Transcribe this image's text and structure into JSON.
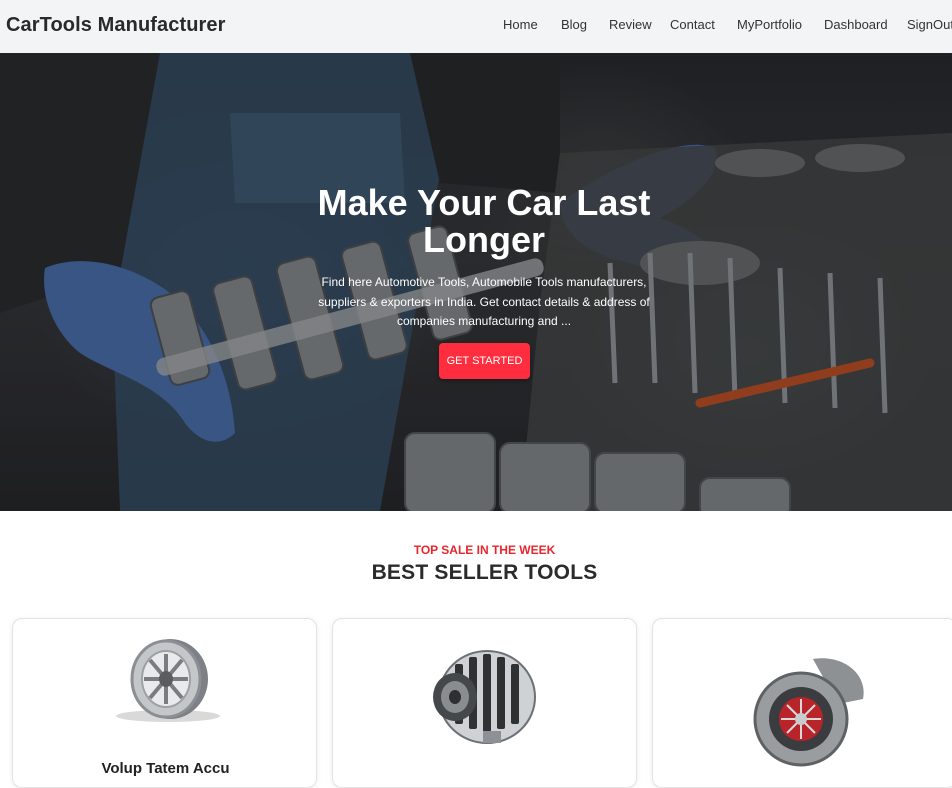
{
  "navbar": {
    "brand": "CarTools Manufacturer",
    "links": [
      "Home",
      "Blog",
      "Review",
      "Contact",
      "MyPortfolio",
      "Dashboard",
      "SignOut"
    ]
  },
  "hero": {
    "title": "Make Your Car Last Longer",
    "description": "Find here Automotive Tools, Automobile Tools manufacturers, suppliers & exporters in India. Get contact details & address of companies manufacturing and ...",
    "cta_label": "GET STARTED"
  },
  "section": {
    "subtitle": "TOP SALE IN THE WEEK",
    "title": "BEST SELLER TOOLS"
  },
  "products": [
    {
      "title": "Volup Tatem Accu",
      "image": "wheel-rim-image"
    },
    {
      "title": "",
      "image": "alternator-image"
    },
    {
      "title": "",
      "image": "turbocharger-image"
    }
  ],
  "colors": {
    "accent": "#ff2d3d",
    "subtitle": "#e8262d",
    "navbar_bg": "#f3f4f6"
  }
}
